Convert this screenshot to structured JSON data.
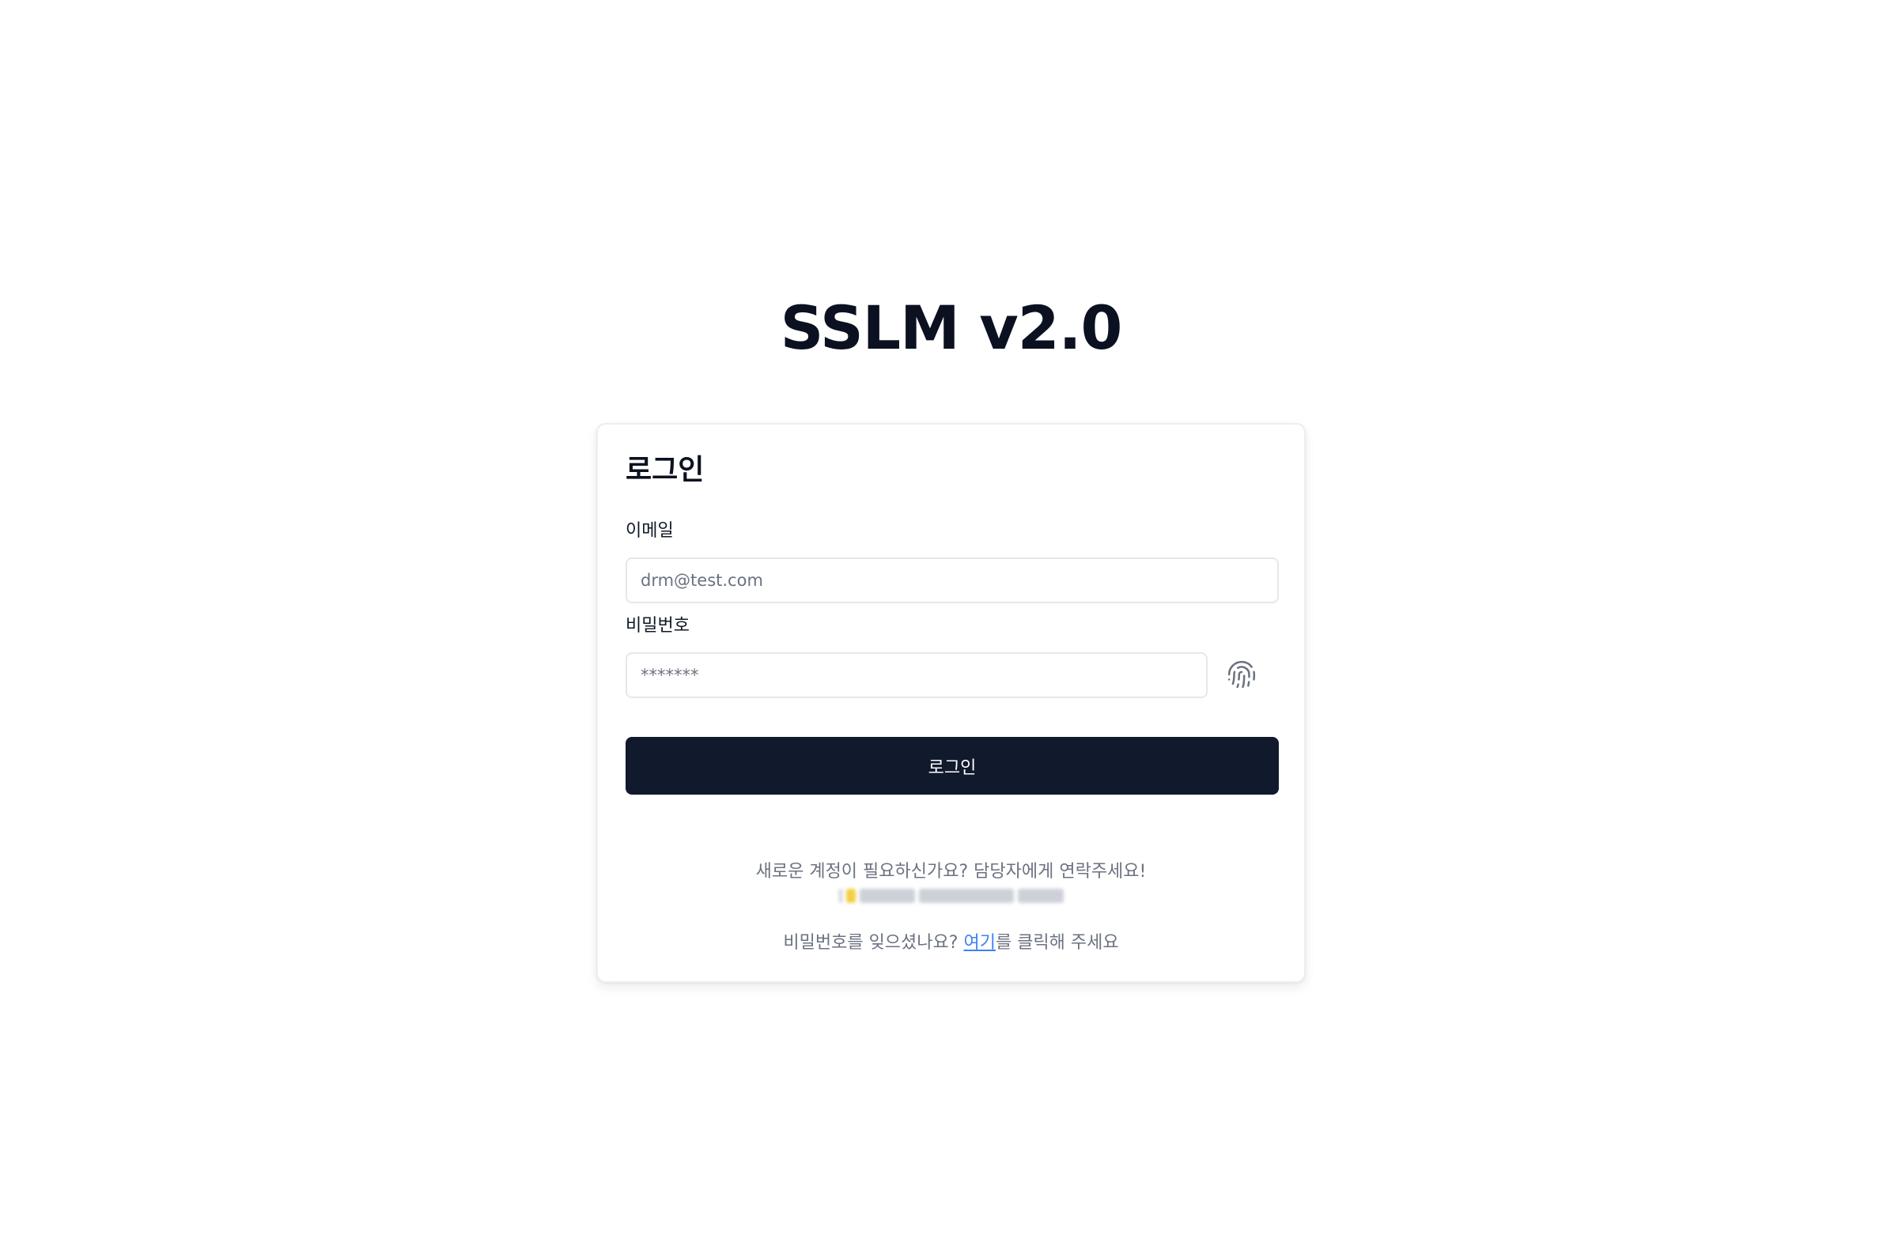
{
  "app": {
    "title": "SSLM v2.0"
  },
  "login": {
    "title": "로그인",
    "email": {
      "label": "이메일",
      "placeholder": "drm@test.com",
      "value": ""
    },
    "password": {
      "label": "비밀번호",
      "placeholder": "*******",
      "value": ""
    },
    "fingerprint_icon": "fingerprint-icon",
    "submit_label": "로그인",
    "signup_note": "새로운 계정이 필요하신가요? 담당자에게 연락주세요!",
    "forgot": {
      "prefix": "비밀번호를 잊으셨나요? ",
      "link": "여기",
      "suffix": "를 클릭해 주세요"
    }
  },
  "colors": {
    "primary_button": "#111a2c",
    "link": "#3b82f6",
    "muted_text": "#6b7280",
    "border": "#e5e7eb"
  }
}
